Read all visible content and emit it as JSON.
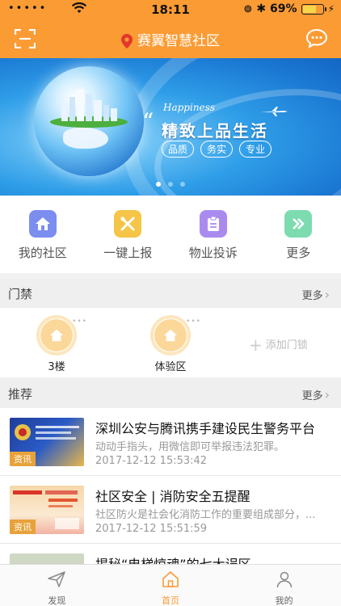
{
  "status_bar": {
    "signal": "•••••",
    "time": "18:11",
    "battery_pct": "69%",
    "battery_level": 0.69
  },
  "header": {
    "title": "赛翼智慧社区"
  },
  "banner": {
    "script_text": "Happiness",
    "slogan": "精致上品生活",
    "tags": [
      "品质",
      "务实",
      "专业"
    ],
    "page_count": 3,
    "active_page": 0
  },
  "quick_menu": [
    {
      "label": "我的社区",
      "icon": "home-icon",
      "color": "#7c8df0"
    },
    {
      "label": "一键上报",
      "icon": "tools-icon",
      "color": "#f6c547"
    },
    {
      "label": "物业投诉",
      "icon": "clipboard-icon",
      "color": "#a98bf0"
    },
    {
      "label": "更多",
      "icon": "double-chevron-icon",
      "color": "#7ddbb0"
    }
  ],
  "door_section": {
    "title": "门禁",
    "more": "更多",
    "items": [
      {
        "label": "3楼",
        "icon": "home-icon"
      },
      {
        "label": "体验区",
        "icon": "home-icon"
      }
    ],
    "add_label": "添加门锁"
  },
  "news_section": {
    "title": "推荐",
    "more": "更多",
    "items": [
      {
        "title": "深圳公安与腾讯携手建设民生警务平台",
        "desc": "动动手指头，用微信即可举报违法犯罪。",
        "time": "2017-12-12 15:53:42",
        "badge": "资讯"
      },
      {
        "title": "社区安全 | 消防安全五提醒",
        "desc": "社区防火是社会化消防工作的重要组成部分，...",
        "time": "2017-12-12 15:51:59",
        "badge": "资讯"
      },
      {
        "title": "揭秘“电梯惊魂”的七大误区",
        "desc": "",
        "time": "",
        "badge": ""
      }
    ]
  },
  "tabbar": [
    {
      "label": "发现",
      "icon": "paper-plane-icon",
      "active": false
    },
    {
      "label": "首页",
      "icon": "home-icon",
      "active": true
    },
    {
      "label": "我的",
      "icon": "user-icon",
      "active": false
    }
  ],
  "colors": {
    "brand": "#fb9b34"
  }
}
